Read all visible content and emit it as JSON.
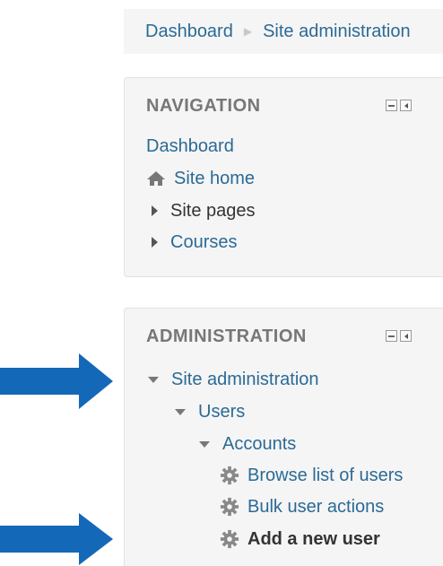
{
  "breadcrumb": {
    "items": [
      "Dashboard",
      "Site administration"
    ]
  },
  "navigation": {
    "title": "NAVIGATION",
    "items": [
      "Dashboard",
      "Site home",
      "Site pages",
      "Courses"
    ]
  },
  "administration": {
    "title": "ADMINISTRATION",
    "site_admin": "Site administration",
    "users": "Users",
    "accounts": "Accounts",
    "items": [
      "Browse list of users",
      "Bulk user actions",
      "Add a new user"
    ]
  },
  "colors": {
    "link": "#2b6a96",
    "arrow": "#1468b8",
    "panel": "#f5f5f5"
  },
  "icons": {
    "home": "home-icon",
    "gear": "gear-icon",
    "expand": "chevron-right-icon",
    "collapse": "chevron-down-icon",
    "pointer": "arrow-right-icon"
  }
}
